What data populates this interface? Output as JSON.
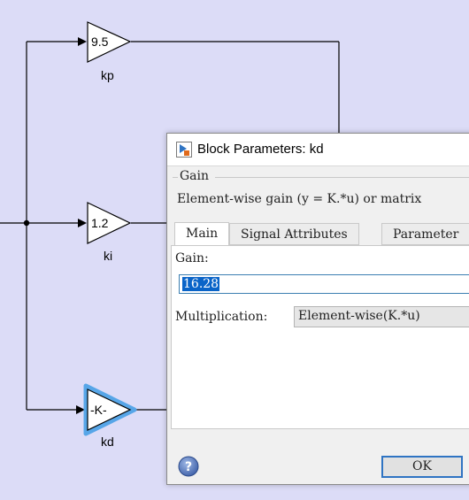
{
  "diagram": {
    "blocks": [
      {
        "id": "kp",
        "value": "9.5",
        "name": "kp"
      },
      {
        "id": "ki",
        "value": "1.2",
        "name": "ki"
      },
      {
        "id": "kd",
        "value": "-K-",
        "name": "kd",
        "selected": true
      }
    ],
    "colors": {
      "background": "#dcdcf7",
      "selection": "#57a6e8"
    }
  },
  "dialog": {
    "title": "Block Parameters: kd",
    "group_title": "Gain",
    "description": "Element-wise gain (y = K.*u) or matrix",
    "tabs": [
      {
        "label": "Main",
        "active": true
      },
      {
        "label": "Signal Attributes",
        "active": false
      },
      {
        "label": "Parameter",
        "active": false
      }
    ],
    "gain_label": "Gain:",
    "gain_value": "16.28",
    "multiplication_label": "Multiplication:",
    "multiplication_value": "Element-wise(K.*u)",
    "ok_label": "OK",
    "help_icon": "question-mark-icon"
  }
}
